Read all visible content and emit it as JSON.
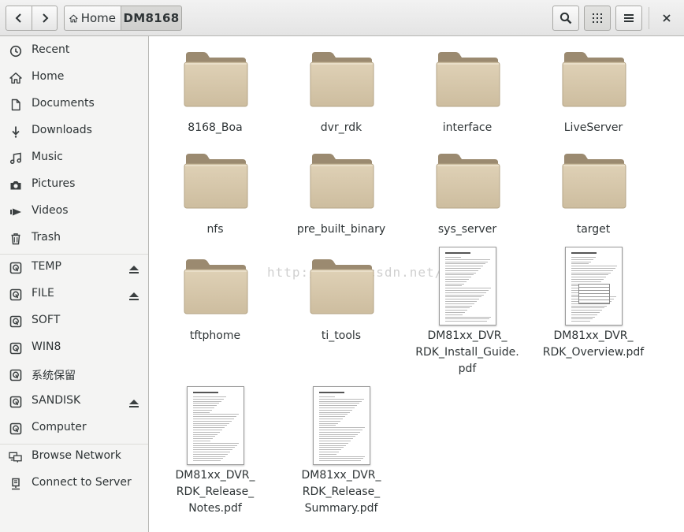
{
  "header": {
    "breadcrumb_home": "Home",
    "breadcrumb_current": "DM8168",
    "close_glyph": "×"
  },
  "sidebar": {
    "places": [
      {
        "label": "Recent",
        "icon": "clock-icon"
      },
      {
        "label": "Home",
        "icon": "home-icon"
      },
      {
        "label": "Documents",
        "icon": "document-icon"
      },
      {
        "label": "Downloads",
        "icon": "download-icon"
      },
      {
        "label": "Music",
        "icon": "music-icon"
      },
      {
        "label": "Pictures",
        "icon": "camera-icon"
      },
      {
        "label": "Videos",
        "icon": "video-icon"
      },
      {
        "label": "Trash",
        "icon": "trash-icon"
      }
    ],
    "devices": [
      {
        "label": "TEMP",
        "icon": "drive-icon",
        "eject": true
      },
      {
        "label": "FILE",
        "icon": "drive-icon",
        "eject": true
      },
      {
        "label": "SOFT",
        "icon": "drive-icon",
        "eject": false
      },
      {
        "label": "WIN8",
        "icon": "drive-icon",
        "eject": false
      },
      {
        "label": "系统保留",
        "icon": "drive-icon",
        "eject": false
      },
      {
        "label": "SANDISK",
        "icon": "drive-icon",
        "eject": true
      },
      {
        "label": "Computer",
        "icon": "drive-icon",
        "eject": false
      }
    ],
    "network": [
      {
        "label": "Browse Network",
        "icon": "network-icon"
      },
      {
        "label": "Connect to Server",
        "icon": "server-icon"
      }
    ]
  },
  "files": [
    {
      "name": "8168_Boa",
      "type": "folder"
    },
    {
      "name": "dvr_rdk",
      "type": "folder"
    },
    {
      "name": "interface",
      "type": "folder"
    },
    {
      "name": "LiveServer",
      "type": "folder"
    },
    {
      "name": "nfs",
      "type": "folder"
    },
    {
      "name": "pre_built_binary",
      "type": "folder"
    },
    {
      "name": "sys_server",
      "type": "folder"
    },
    {
      "name": "target",
      "type": "folder"
    },
    {
      "name": "tftphome",
      "type": "folder"
    },
    {
      "name": "ti_tools",
      "type": "folder"
    },
    {
      "name": "DM81xx_DVR_\nRDK_Install_Guide.\npdf",
      "type": "pdf"
    },
    {
      "name": "DM81xx_DVR_\nRDK_Overview.pdf",
      "type": "pdf"
    },
    {
      "name": "DM81xx_DVR_\nRDK_Release_\nNotes.pdf",
      "type": "pdf"
    },
    {
      "name": "DM81xx_DVR_\nRDK_Release_\nSummary.pdf",
      "type": "pdf"
    }
  ],
  "watermark": "http://blog.csdn.net/",
  "colors": {
    "folder_body": "#d8c8aa",
    "folder_tab": "#9b8a70",
    "accent": "#2e3436"
  }
}
